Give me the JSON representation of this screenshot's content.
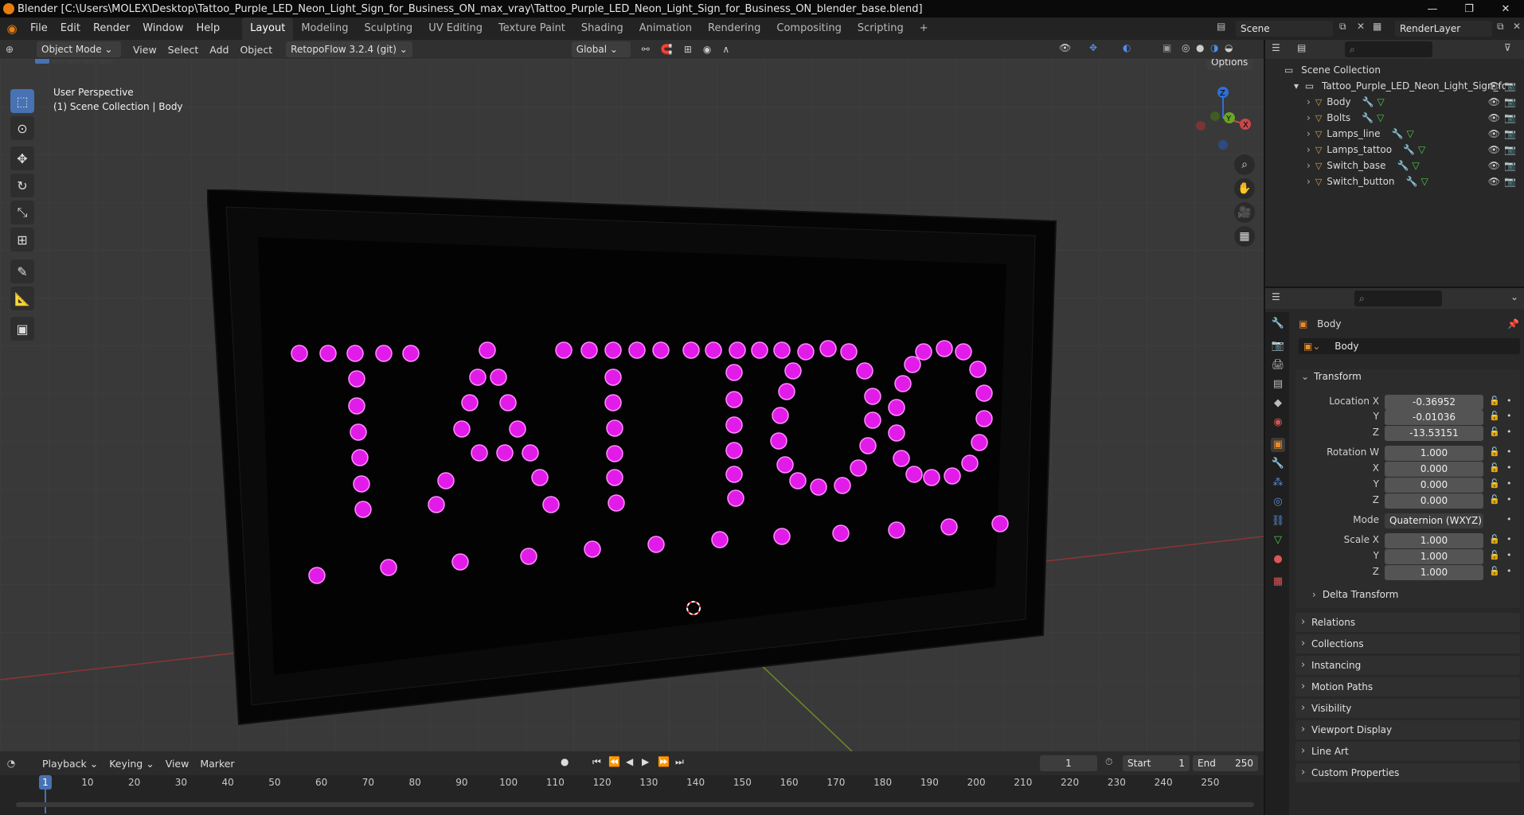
{
  "window": {
    "title": "Blender [C:\\Users\\MOLEX\\Desktop\\Tattoo_Purple_LED_Neon_Light_Sign_for_Business_ON_max_vray\\Tattoo_Purple_LED_Neon_Light_Sign_for_Business_ON_blender_base.blend]",
    "controls": [
      "—",
      "❐",
      "✕"
    ]
  },
  "menu": [
    "File",
    "Edit",
    "Render",
    "Window",
    "Help"
  ],
  "workspaces": [
    "Layout",
    "Modeling",
    "Sculpting",
    "UV Editing",
    "Texture Paint",
    "Shading",
    "Animation",
    "Rendering",
    "Compositing",
    "Scripting"
  ],
  "workspace_add": "+",
  "active_workspace": "Layout",
  "scene": {
    "name": "Scene",
    "render_layer": "RenderLayer"
  },
  "viewport_header": {
    "mode": "Object Mode",
    "menus": [
      "View",
      "Select",
      "Add",
      "Object"
    ],
    "addon": "RetopoFlow 3.2.4 (git)",
    "orientation": "Global",
    "options": "Options"
  },
  "viewport": {
    "perspective": "User Perspective",
    "collection_info": "(1) Scene Collection | Body",
    "sign_text": "TATTOO",
    "led_color": "#e21ce8",
    "gizmo": {
      "z": "Z",
      "y": "Y",
      "x": "X"
    }
  },
  "outliner": {
    "root": "Scene Collection",
    "collection": "Tattoo_Purple_LED_Neon_Light_Sign_for",
    "objects": [
      "Body",
      "Bolts",
      "Lamps_line",
      "Lamps_tattoo",
      "Switch_base",
      "Switch_button"
    ]
  },
  "properties": {
    "object_name": "Body",
    "data_name": "Body",
    "transform_header": "Transform",
    "location": {
      "label": "Location X",
      "x": "-0.36952",
      "y": "-0.01036",
      "z": "-13.53151"
    },
    "rotation": {
      "label": "Rotation W",
      "w": "1.000",
      "x": "0.000",
      "y": "0.000",
      "z": "0.000"
    },
    "mode_label": "Mode",
    "mode_value": "Quaternion (WXYZ)",
    "scale": {
      "label": "Scale X",
      "x": "1.000",
      "y": "1.000",
      "z": "1.000"
    },
    "axis_labels": {
      "y": "Y",
      "z": "Z",
      "x": "X"
    },
    "delta": "Delta Transform",
    "panels": [
      "Relations",
      "Collections",
      "Instancing",
      "Motion Paths",
      "Visibility",
      "Viewport Display",
      "Line Art",
      "Custom Properties"
    ]
  },
  "timeline": {
    "menus": [
      "Playback",
      "Keying",
      "View",
      "Marker"
    ],
    "current_frame": "1",
    "start_label": "Start",
    "start": "1",
    "end_label": "End",
    "end": "250",
    "ticks": [
      "1",
      "10",
      "20",
      "30",
      "40",
      "50",
      "60",
      "70",
      "80",
      "90",
      "100",
      "110",
      "120",
      "130",
      "140",
      "150",
      "160",
      "170",
      "180",
      "190",
      "200",
      "210",
      "220",
      "230",
      "240",
      "250"
    ]
  }
}
